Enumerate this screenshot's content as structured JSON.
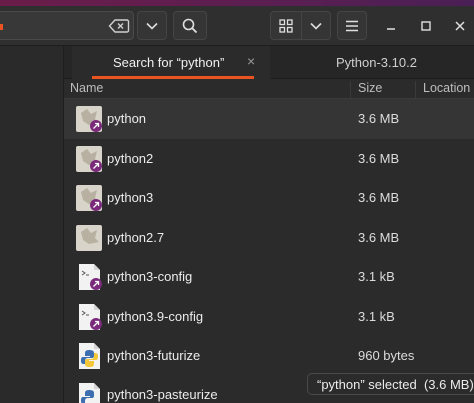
{
  "tabs": [
    {
      "label": "Search for “python”",
      "active": true
    },
    {
      "label": "Python-3.10.2",
      "active": false
    }
  ],
  "columns": {
    "name": "Name",
    "size": "Size",
    "location": "Location"
  },
  "files": [
    {
      "name": "python",
      "size": "3.6 MB",
      "icon": "symlink-executable-icon"
    },
    {
      "name": "python2",
      "size": "3.6 MB",
      "icon": "symlink-executable-icon"
    },
    {
      "name": "python3",
      "size": "3.6 MB",
      "icon": "symlink-executable-icon"
    },
    {
      "name": "python2.7",
      "size": "3.6 MB",
      "icon": "executable-icon"
    },
    {
      "name": "python3-config",
      "size": "3.1 kB",
      "icon": "symlink-script-icon"
    },
    {
      "name": "python3.9-config",
      "size": "3.1 kB",
      "icon": "symlink-script-icon"
    },
    {
      "name": "python3-futurize",
      "size": "960 bytes",
      "icon": "python-script-icon"
    },
    {
      "name": "python3-pasteurize",
      "size": "",
      "icon": "python-script-icon"
    }
  ],
  "status": "“python” selected  (3.6 MB)",
  "colors": {
    "accent": "#e95420",
    "symlink_badge": "#7b2a7b",
    "background": "#2b2b2b"
  }
}
